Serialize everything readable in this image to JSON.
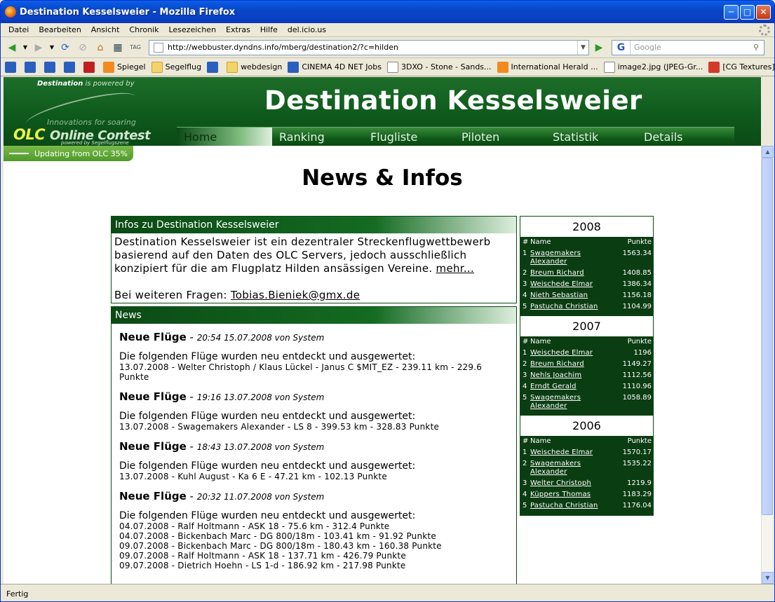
{
  "window": {
    "title": "Destination Kesselsweier - Mozilla Firefox"
  },
  "menu": [
    "Datei",
    "Bearbeiten",
    "Ansicht",
    "Chronik",
    "Lesezeichen",
    "Extras",
    "Hilfe",
    "del.icio.us"
  ],
  "url": "http://webbuster.dyndns.info/mberg/destination2/?c=hilden",
  "search": {
    "engine_icon": "G",
    "placeholder": "Google"
  },
  "bookmarks": [
    {
      "icon": "blue",
      "label": ""
    },
    {
      "icon": "blue",
      "label": ""
    },
    {
      "icon": "blue",
      "label": ""
    },
    {
      "icon": "blue",
      "label": ""
    },
    {
      "icon": "red",
      "label": ""
    },
    {
      "icon": "rss",
      "label": "Spiegel"
    },
    {
      "icon": "folder",
      "label": "Segelflug"
    },
    {
      "icon": "blue",
      "label": ""
    },
    {
      "icon": "folder",
      "label": "webdesign"
    },
    {
      "icon": "blue",
      "label": "CINEMA 4D NET Jobs"
    },
    {
      "icon": "page",
      "label": "3DXO - Stone - Sands..."
    },
    {
      "icon": "rss",
      "label": "International Herald ..."
    },
    {
      "icon": "page",
      "label": "image2.jpg (JPEG-Gr..."
    },
    {
      "icon": "cg",
      "label": "[CG Textures] - The ..."
    }
  ],
  "status": "Fertig",
  "site": {
    "powered": "Destination",
    "powered_rest": " is powered by",
    "innovation": "Innovations for soaring",
    "olc_logo": "OLC",
    "olc_logo_rest": "Online Contest",
    "olc_powered": "powered by Segelflugszene",
    "title": "Destination Kesselsweier",
    "nav": [
      "Home",
      "Ranking",
      "Flugliste",
      "Piloten",
      "Statistik",
      "Details"
    ],
    "active_nav": "Home",
    "update_status": "Updating from OLC 35%"
  },
  "page_title": "News & Infos",
  "infos": {
    "heading": "Infos zu Destination Kesselsweier",
    "text": "Destination Kesselsweier ist ein dezentraler Streckenflugwettbewerb basierend auf den Daten des OLC Servers, jedoch ausschließlich konzipiert für die am Flugplatz Hilden ansässigen Vereine.",
    "more_link": "mehr...",
    "contact_prefix": "Bei weiteren Fragen:",
    "contact_email": "Tobias.Bieniek@gmx.de"
  },
  "news": {
    "heading": "News",
    "items": [
      {
        "title": "Neue Flüge",
        "meta": "20:54 15.07.2008 von System",
        "intro": "Die folgenden Flüge wurden neu entdeckt und ausgewertet:",
        "lines": [
          "13.07.2008 - Welter Christoph / Klaus Lückel - Janus C $MIT_EZ - 239.11 km - 229.6 Punkte"
        ]
      },
      {
        "title": "Neue Flüge",
        "meta": "19:16 13.07.2008 von System",
        "intro": "Die folgenden Flüge wurden neu entdeckt und ausgewertet:",
        "lines": [
          "13.07.2008 - Swagemakers Alexander - LS 8 - 399.53 km - 328.83 Punkte"
        ]
      },
      {
        "title": "Neue Flüge",
        "meta": "18:43 13.07.2008 von System",
        "intro": "Die folgenden Flüge wurden neu entdeckt und ausgewertet:",
        "lines": [
          "13.07.2008 - Kuhl August - Ka 6 E - 47.21 km - 102.13 Punkte"
        ]
      },
      {
        "title": "Neue Flüge",
        "meta": "20:32 11.07.2008 von System",
        "intro": "Die folgenden Flüge wurden neu entdeckt und ausgewertet:",
        "lines": [
          "04.07.2008 - Ralf Holtmann - ASK 18 - 75.6 km - 312.4 Punkte",
          "04.07.2008 - Bickenbach Marc - DG 800/18m - 103.41 km - 91.92 Punkte",
          "09.07.2008 - Bickenbach Marc - DG 800/18m - 180.43 km - 160.38 Punkte",
          "09.07.2008 - Ralf Holtmann - ASK 18 - 137.71 km - 426.79 Punkte",
          "09.07.2008 - Dietrich Hoehn - LS 1-d - 186.92 km - 217.98 Punkte"
        ]
      }
    ]
  },
  "rankings": {
    "col_num": "#",
    "col_name": "Name",
    "col_points": "Punkte",
    "years": [
      {
        "year": "2008",
        "rows": [
          {
            "n": "1",
            "name": "Swagemakers Alexander",
            "points": "1563.34"
          },
          {
            "n": "2",
            "name": "Breum Richard",
            "points": "1408.85"
          },
          {
            "n": "3",
            "name": "Weischede Elmar",
            "points": "1386.34"
          },
          {
            "n": "4",
            "name": "Nieth Sebastian",
            "points": "1156.18"
          },
          {
            "n": "5",
            "name": "Pastucha Christian",
            "points": "1104.99"
          }
        ]
      },
      {
        "year": "2007",
        "rows": [
          {
            "n": "1",
            "name": "Weischede Elmar",
            "points": "1196"
          },
          {
            "n": "2",
            "name": "Breum Richard",
            "points": "1149.27"
          },
          {
            "n": "3",
            "name": "Nehls Joachim",
            "points": "1112.56"
          },
          {
            "n": "4",
            "name": "Erndt Gerald",
            "points": "1110.96"
          },
          {
            "n": "5",
            "name": "Swagemakers Alexander",
            "points": "1058.89"
          }
        ]
      },
      {
        "year": "2006",
        "rows": [
          {
            "n": "1",
            "name": "Weischede Elmar",
            "points": "1570.17"
          },
          {
            "n": "2",
            "name": "Swagemakers Alexander",
            "points": "1535.22"
          },
          {
            "n": "3",
            "name": "Welter Christoph",
            "points": "1219.9"
          },
          {
            "n": "4",
            "name": "Küppers Thomas",
            "points": "1183.29"
          },
          {
            "n": "5",
            "name": "Pastucha Christian",
            "points": "1176.04"
          }
        ]
      }
    ]
  }
}
